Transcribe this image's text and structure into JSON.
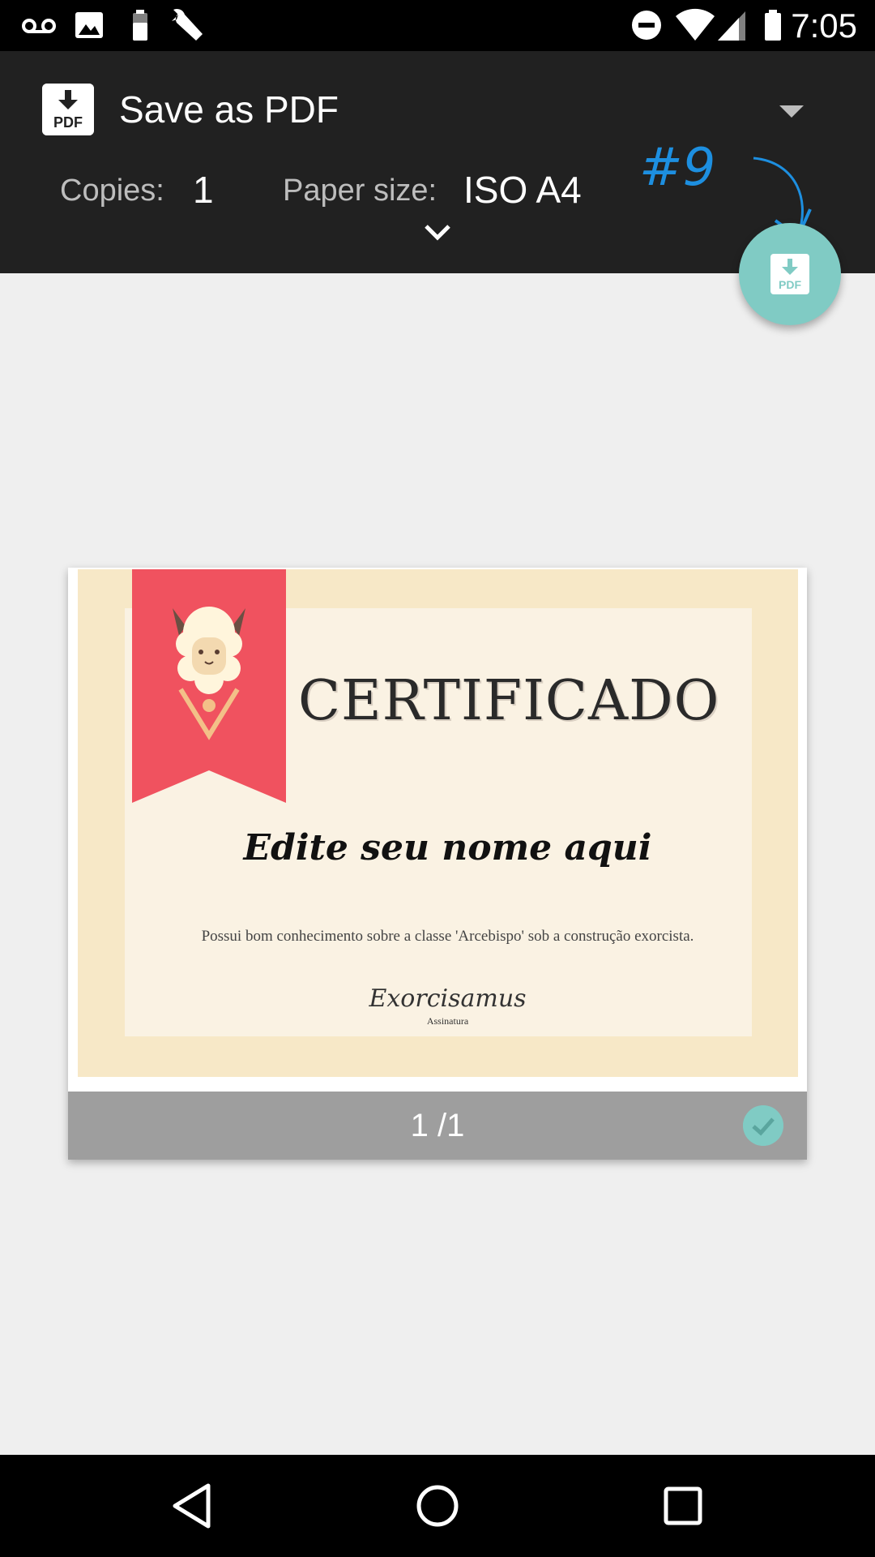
{
  "status_bar": {
    "time": "7:05",
    "icons": [
      "voicemail-icon",
      "image-icon",
      "battery-small-icon",
      "wrench-icon",
      "do-not-disturb-icon",
      "wifi-icon",
      "signal-icon",
      "battery-icon"
    ]
  },
  "print_header": {
    "printer_name": "Save as PDF",
    "copies_label": "Copies:",
    "copies_value": "1",
    "paper_size_label": "Paper size:",
    "paper_size_value": "ISO A4",
    "annotation": "#9"
  },
  "fab": {
    "icon": "pdf-download-icon"
  },
  "preview": {
    "certificate": {
      "title": "CERTIFICADO",
      "name": "Edite seu nome aqui",
      "description": "Possui bom conhecimento sobre a classe 'Arcebispo' sob a construção exorcista.",
      "signature": "Exorcisamus",
      "signature_label": "Assinatura"
    },
    "page_indicator": "1 /1"
  },
  "colors": {
    "header_bg": "#212121",
    "accent": "#80cbc4",
    "ribbon": "#f0525f",
    "cert_border": "#f7e8c7",
    "cert_inner": "#faf2e3"
  },
  "nav_bar": {
    "buttons": [
      "back-icon",
      "home-icon",
      "recents-icon"
    ]
  }
}
